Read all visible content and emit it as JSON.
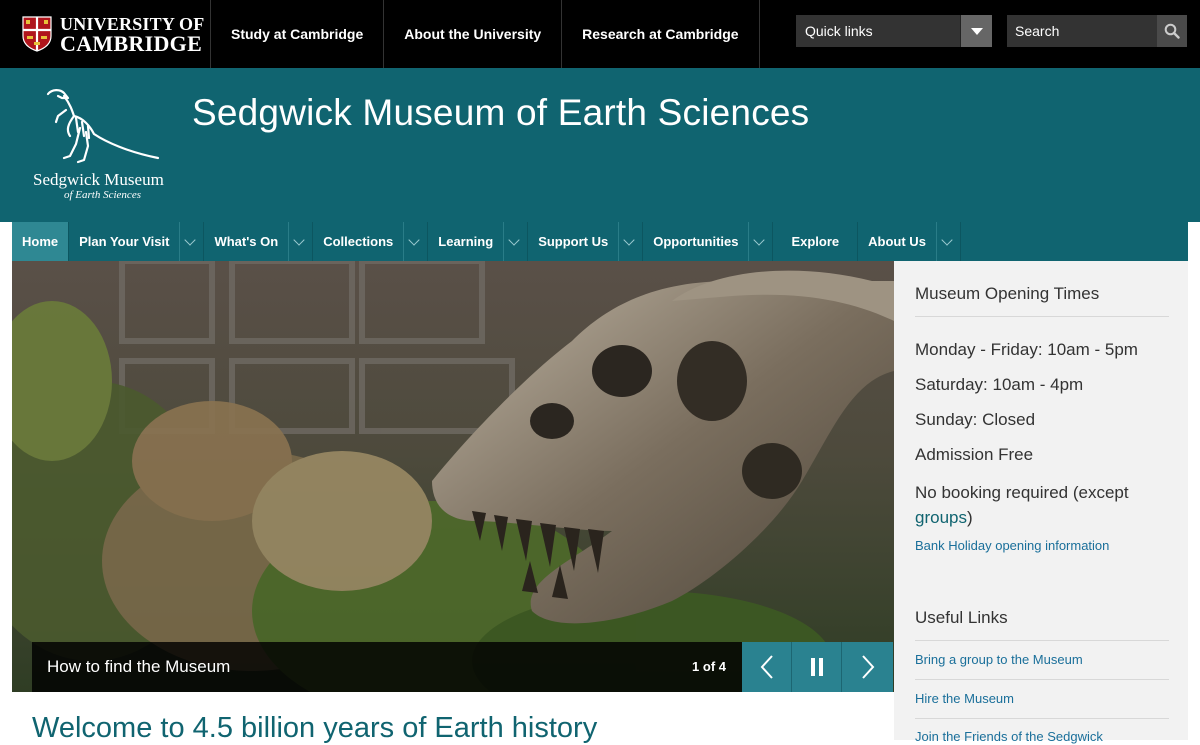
{
  "topbar": {
    "university_line1": "UNIVERSITY OF",
    "university_line2": "CAMBRIDGE",
    "nav": [
      "Study at Cambridge",
      "About the University",
      "Research at Cambridge"
    ],
    "quick_links_label": "Quick links",
    "search_placeholder": "Search"
  },
  "header": {
    "logo_line1": "Sedgwick Museum",
    "logo_line2": "of Earth Sciences",
    "site_title": "Sedgwick Museum of Earth Sciences"
  },
  "mainnav": {
    "items": [
      "Home",
      "Plan Your Visit",
      "What's On",
      "Collections",
      "Learning",
      "Support Us",
      "Opportunities",
      "Explore",
      "About Us"
    ]
  },
  "hero": {
    "caption": "How to find the Museum",
    "counter": "1 of 4"
  },
  "sidebar": {
    "opening_title": "Museum Opening Times",
    "weekday": "Monday - Friday: 10am - 5pm",
    "saturday": "Saturday: 10am - 4pm",
    "sunday": "Sunday: Closed",
    "admission": "Admission Free",
    "booking_prefix": "No booking required (except",
    "booking_link": "groups",
    "booking_suffix": ")",
    "bank_holiday": "Bank Holiday opening information",
    "useful_title": "Useful Links",
    "links": [
      "Bring a group to the Museum",
      "Hire the Museum",
      "Join the Friends of the Sedgwick"
    ]
  },
  "main": {
    "welcome": "Welcome to 4.5 billion years of Earth history"
  }
}
